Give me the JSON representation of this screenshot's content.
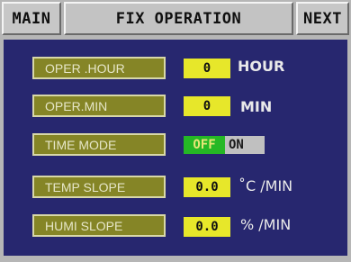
{
  "header": {
    "main_label": "MAIN",
    "title": "FIX OPERATION",
    "next_label": "NEXT"
  },
  "rows": [
    {
      "label": "OPER .HOUR",
      "value": "0",
      "unit": "HOUR"
    },
    {
      "label": "OPER.MIN",
      "value": "0",
      "unit": "MIN"
    },
    {
      "label": "TIME MODE",
      "off_label": "OFF",
      "on_label": "ON",
      "state": "OFF"
    },
    {
      "label": "TEMP SLOPE",
      "value": "0.0",
      "unit": "˚C /MIN"
    },
    {
      "label": "HUMI SLOPE",
      "value": "0.0",
      "unit": "% /MIN"
    }
  ],
  "colors": {
    "panel": "#27276f",
    "label_bg": "#858526",
    "value_bg": "#e7e72a",
    "toggle_active": "#25b825"
  }
}
